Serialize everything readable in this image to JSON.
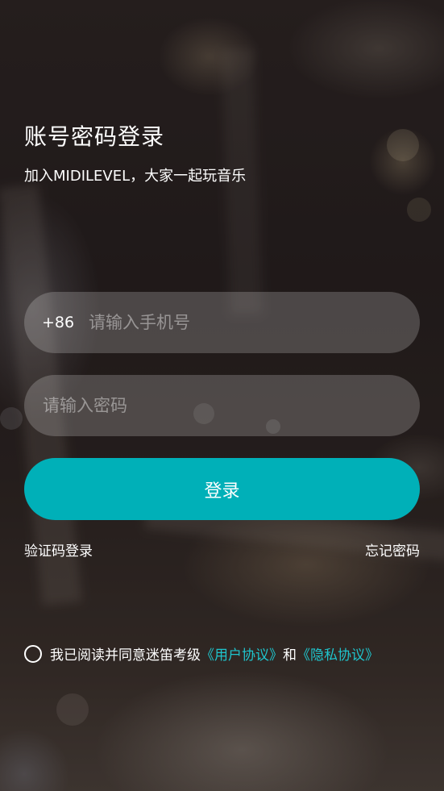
{
  "header": {
    "title": "账号密码登录",
    "subtitle": "加入MIDILEVEL，大家一起玩音乐"
  },
  "form": {
    "country_code": "+86",
    "phone_placeholder": "请输入手机号",
    "phone_value": "",
    "password_placeholder": "请输入密码",
    "password_value": "",
    "login_label": "登录"
  },
  "links": {
    "sms_login": "验证码登录",
    "forgot_password": "忘记密码"
  },
  "agreement": {
    "checked": false,
    "prefix": "我已阅读并同意迷笛考级",
    "user_agreement": "《用户协议》",
    "conjunction": "和",
    "privacy_policy": "《隐私协议》"
  },
  "colors": {
    "accent": "#00b0b8",
    "link_accent": "#1fc4cc",
    "text": "#ffffff"
  },
  "icons": {
    "agreement_checkbox": "radio-circle-icon"
  }
}
